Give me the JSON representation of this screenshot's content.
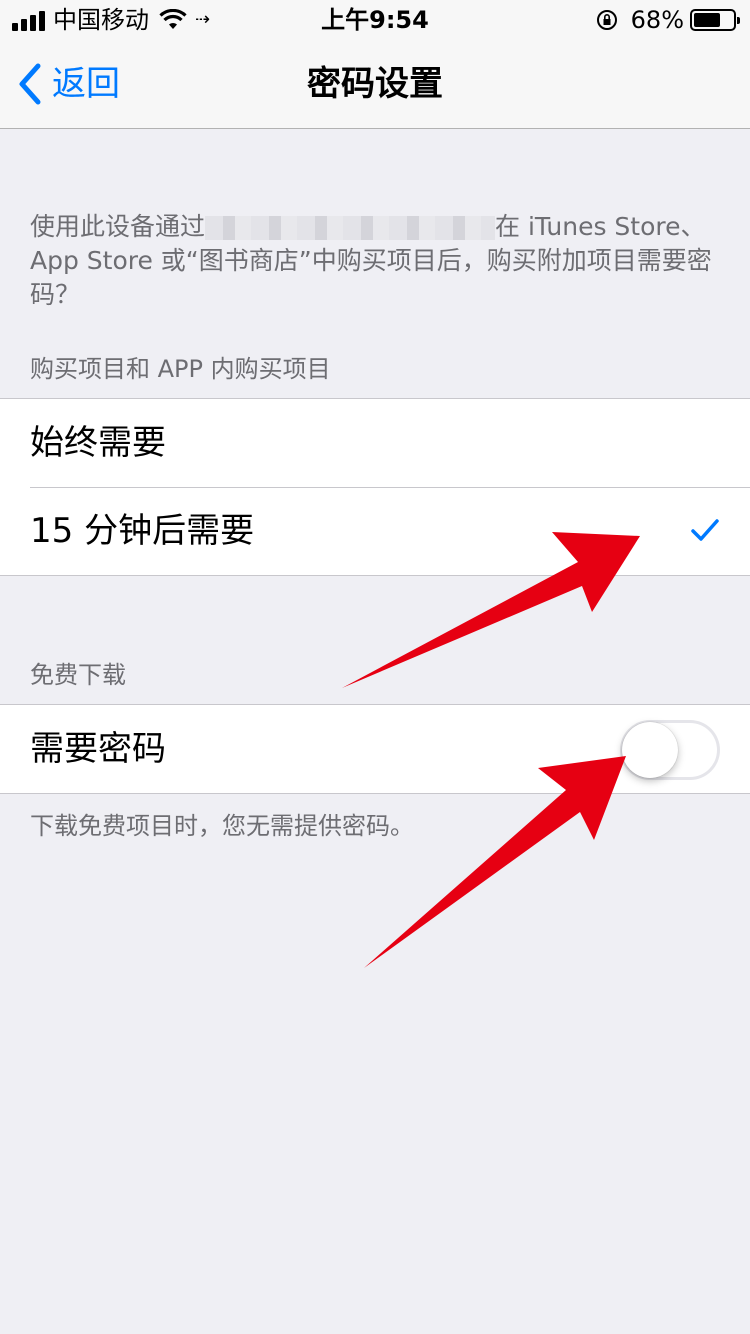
{
  "status_bar": {
    "carrier": "中国移动",
    "time": "上午9:54",
    "battery_percent": "68%",
    "battery_level": 0.68
  },
  "nav": {
    "back_label": "返回",
    "title": "密码设置"
  },
  "description": {
    "before_redaction": "使用此设备通过",
    "after_redaction": "在 iTunes Store、App Store 或“图书商店”中购买项目后，购买附加项目需要密码？"
  },
  "purchase_section": {
    "header": "购买项目和 APP 内购买项目",
    "options": [
      {
        "label": "始终需要",
        "selected": false
      },
      {
        "label": "15 分钟后需要",
        "selected": true
      }
    ]
  },
  "free_section": {
    "header": "免费下载",
    "row_label": "需要密码",
    "toggle_on": false,
    "footer": "下载免费项目时，您无需提供密码。"
  },
  "colors": {
    "accent": "#007aff",
    "annotation_arrow": "#e60012",
    "background": "#efeff4"
  }
}
